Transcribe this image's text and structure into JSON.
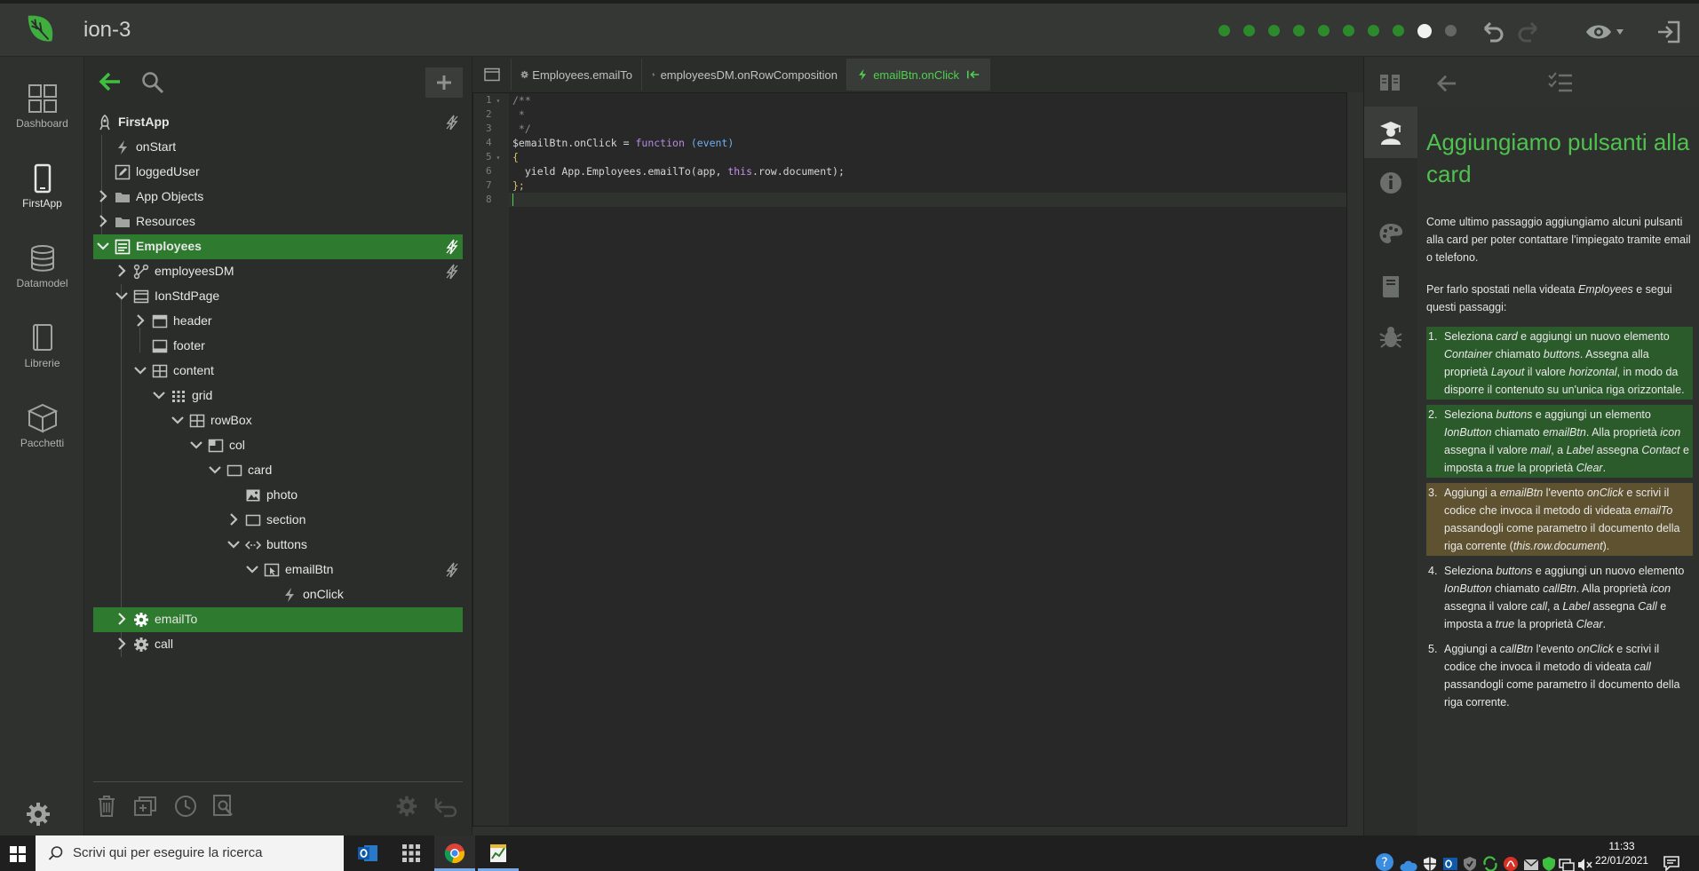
{
  "app": {
    "title": "ion-3"
  },
  "rail": {
    "items": [
      {
        "label": "Dashboard"
      },
      {
        "label": "FirstApp"
      },
      {
        "label": "Datamodel"
      },
      {
        "label": "Librerie"
      },
      {
        "label": "Pacchetti"
      }
    ]
  },
  "tree": {
    "nodes": [
      {
        "label": "FirstApp"
      },
      {
        "label": "onStart"
      },
      {
        "label": "loggedUser"
      },
      {
        "label": "App Objects"
      },
      {
        "label": "Resources"
      },
      {
        "label": "Employees"
      },
      {
        "label": "employeesDM"
      },
      {
        "label": "IonStdPage"
      },
      {
        "label": "header"
      },
      {
        "label": "footer"
      },
      {
        "label": "content"
      },
      {
        "label": "grid"
      },
      {
        "label": "rowBox"
      },
      {
        "label": "col"
      },
      {
        "label": "card"
      },
      {
        "label": "photo"
      },
      {
        "label": "section"
      },
      {
        "label": "buttons"
      },
      {
        "label": "emailBtn"
      },
      {
        "label": "onClick"
      },
      {
        "label": "emailTo"
      },
      {
        "label": "call"
      }
    ]
  },
  "editor": {
    "tabs": [
      {
        "label": "Employees.emailTo"
      },
      {
        "label": "employeesDM.onRowComposition"
      },
      {
        "label": "emailBtn.onClick"
      }
    ],
    "line_numbers": [
      "1",
      "2",
      "3",
      "4",
      "5",
      "6",
      "7",
      "8"
    ],
    "code": {
      "l1": "/**",
      "l2": " *",
      "l3": " */",
      "l4_a": "$emailBtn.onClick = ",
      "l4_kw": "function",
      "l4_b": " ",
      "l4_p": "(event)",
      "l5": "{",
      "l6_a": "  yield App.Employees.emailTo(app, ",
      "l6_this": "this",
      "l6_b": ".row.document);",
      "l7": "};"
    }
  },
  "help": {
    "title": "Aggiungiamo pulsanti alla card",
    "p1": "Come ultimo passaggio aggiungiamo alcuni pulsanti alla card per poter contattare l'impiegato tramite email o telefono.",
    "p2_a": "Per farlo spostati nella videata ",
    "p2_em": "Employees",
    "p2_b": " e segui questi passaggi:",
    "steps": [
      {
        "n": "1.",
        "parts": [
          "Seleziona ",
          "card",
          " e aggiungi un nuovo elemento ",
          "Container",
          " chiamato ",
          "buttons",
          ". Assegna alla proprietà ",
          "Layout",
          " il valore ",
          "horizontal",
          ", in modo da disporre il contenuto su un'unica riga orizzontale."
        ]
      },
      {
        "n": "2.",
        "parts": [
          "Seleziona ",
          "buttons",
          " e aggiungi un elemento ",
          "IonButton",
          " chiamato ",
          "emailBtn",
          ". Alla proprietà ",
          "icon",
          " assegna il valore ",
          "mail",
          ", a ",
          "Label",
          " assegna ",
          "Contact",
          " e imposta a ",
          "true",
          " la proprietà ",
          "Clear",
          "."
        ]
      },
      {
        "n": "3.",
        "parts": [
          "Aggiungi a ",
          "emailBtn",
          " l'evento ",
          "onClick",
          " e scrivi il codice che invoca il metodo di videata ",
          "emailTo",
          " passandogli come parametro il documento della riga corrente (",
          "this.row.document",
          ")."
        ]
      },
      {
        "n": "4.",
        "parts": [
          "Seleziona ",
          "buttons",
          " e aggiungi un nuovo elemento ",
          "IonButton",
          " chiamato ",
          "callBtn",
          ". Alla proprietà ",
          "icon",
          " assegna il valore ",
          "call",
          ", a ",
          "Label",
          " assegna ",
          "Call",
          " e imposta a ",
          "true",
          " la proprietà ",
          "Clear",
          "."
        ]
      },
      {
        "n": "5.",
        "parts": [
          "Aggiungi a ",
          "callBtn",
          " l'evento ",
          "onClick",
          " e scrivi il codice che invoca il metodo di videata ",
          "call",
          " passandogli come parametro il documento della riga corrente."
        ]
      }
    ]
  },
  "taskbar": {
    "search_placeholder": "Scrivi qui per eseguire la ricerca",
    "time": "11:33",
    "date": "22/01/2021"
  },
  "colors": {
    "accent": "#2e7a2e",
    "accent_text": "#4fc14f",
    "step_done": "#2b5a2b",
    "step_current": "#5e5230"
  }
}
